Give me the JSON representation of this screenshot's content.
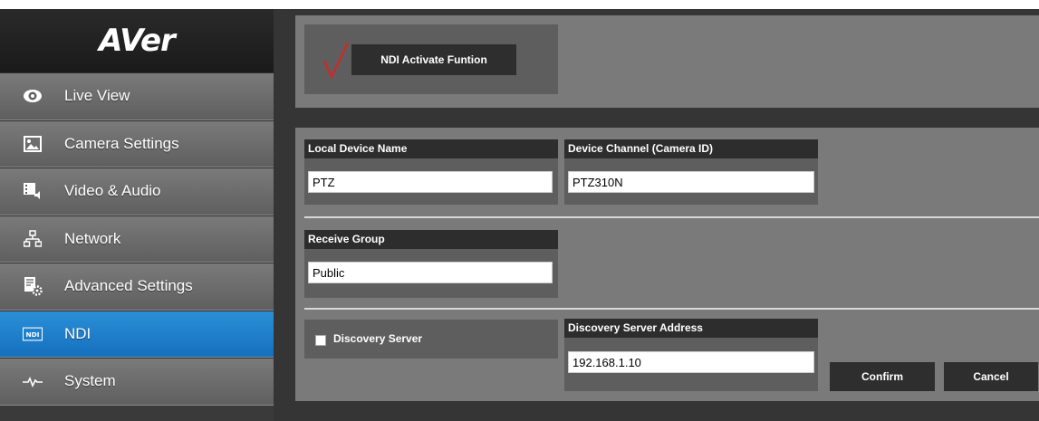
{
  "sidebar": {
    "logo_text": "AVer",
    "items": [
      {
        "label": "Live View",
        "icon": "eye-icon",
        "active": false
      },
      {
        "label": "Camera Settings",
        "icon": "image-icon",
        "active": false
      },
      {
        "label": "Video & Audio",
        "icon": "video-audio-icon",
        "active": false
      },
      {
        "label": "Network",
        "icon": "network-icon",
        "active": false
      },
      {
        "label": "Advanced Settings",
        "icon": "advanced-settings-icon",
        "active": false
      },
      {
        "label": "NDI",
        "icon": "ndi-icon",
        "active": true
      },
      {
        "label": "System",
        "icon": "pulse-icon",
        "active": false
      }
    ]
  },
  "ndi": {
    "activate_label": "NDI Activate Funtion",
    "activate_checked": true,
    "local_device_name": {
      "label": "Local Device Name",
      "value": "PTZ"
    },
    "device_channel": {
      "label": "Device Channel (Camera ID)",
      "value": "PTZ310N"
    },
    "receive_group": {
      "label": "Receive Group",
      "value": "Public"
    },
    "discovery_server": {
      "label": "Discovery Server",
      "checked": false
    },
    "discovery_server_address": {
      "label": "Discovery Server Address",
      "value": "192.168.1.10"
    },
    "confirm_label": "Confirm",
    "cancel_label": "Cancel"
  },
  "colors": {
    "active_menu": "#1f82cc",
    "check_mark": "#e02020",
    "panel": "#7a7a7a",
    "button": "#2e2e2e"
  }
}
